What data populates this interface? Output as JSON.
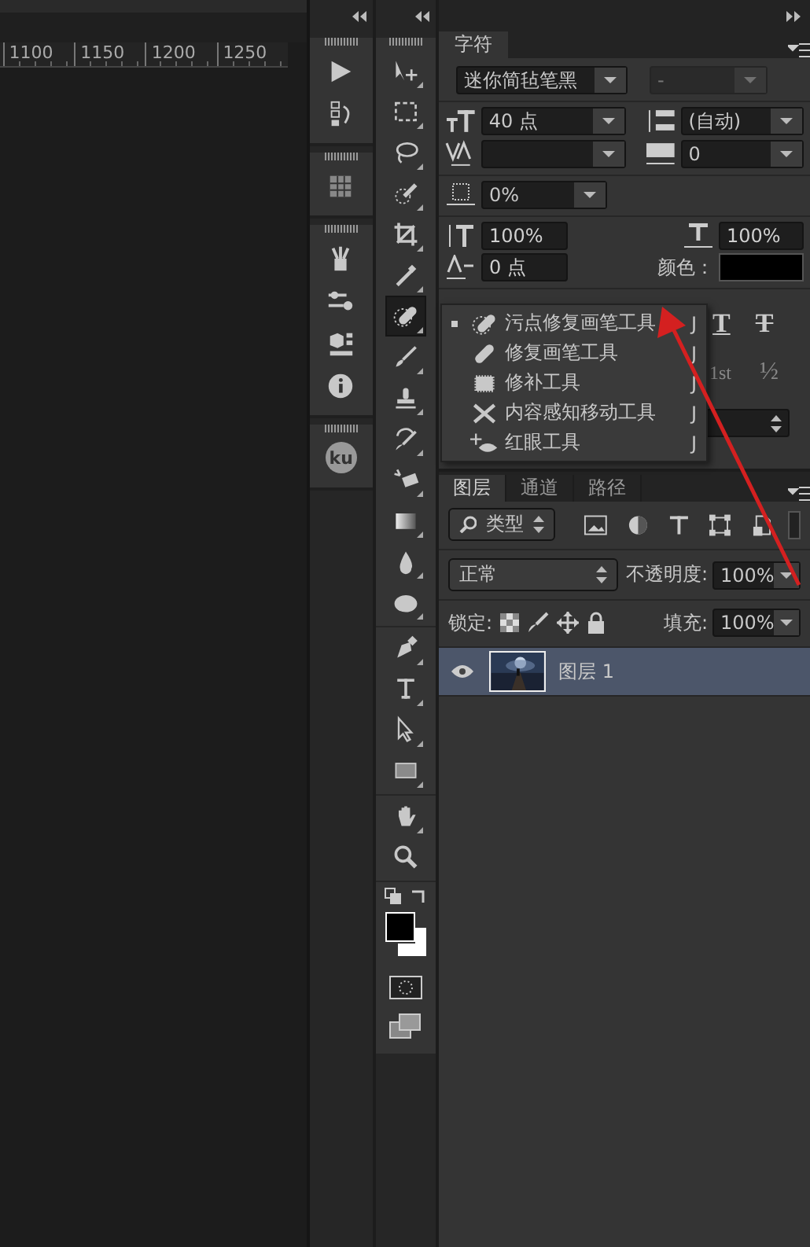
{
  "ruler": {
    "labels": [
      "1100",
      "1150",
      "1200",
      "1250"
    ]
  },
  "dock": {
    "groups": [
      {
        "items": [
          {
            "kind": "actions"
          },
          {
            "kind": "history"
          }
        ]
      },
      {
        "items": [
          {
            "kind": "swatches"
          }
        ]
      },
      {
        "items": [
          {
            "kind": "brushes"
          },
          {
            "kind": "brush-settings"
          },
          {
            "kind": "properties"
          },
          {
            "kind": "info"
          }
        ]
      },
      {
        "items": [
          {
            "kind": "ku",
            "label": "ku"
          }
        ]
      }
    ]
  },
  "toolbar": {
    "groups": [
      {
        "tools": [
          {
            "kind": "move",
            "selected": false,
            "flyout": true
          },
          {
            "kind": "marquee",
            "selected": false,
            "flyout": true
          },
          {
            "kind": "lasso",
            "selected": false,
            "flyout": true
          },
          {
            "kind": "quick-select",
            "selected": false,
            "flyout": true
          },
          {
            "kind": "crop",
            "selected": false,
            "flyout": true
          },
          {
            "kind": "eyedropper",
            "selected": false,
            "flyout": true
          },
          {
            "kind": "spot-healing",
            "selected": true,
            "flyout": true
          },
          {
            "kind": "brush",
            "selected": false,
            "flyout": true
          },
          {
            "kind": "stamp",
            "selected": false,
            "flyout": true
          },
          {
            "kind": "history-brush",
            "selected": false,
            "flyout": true
          },
          {
            "kind": "eraser",
            "selected": false,
            "flyout": true
          },
          {
            "kind": "gradient",
            "selected": false,
            "flyout": true
          },
          {
            "kind": "blur",
            "selected": false,
            "flyout": true
          },
          {
            "kind": "dodge",
            "selected": false,
            "flyout": true
          }
        ]
      },
      {
        "tools": [
          {
            "kind": "pen",
            "selected": false,
            "flyout": true
          },
          {
            "kind": "type",
            "selected": false,
            "flyout": true
          },
          {
            "kind": "path-select",
            "selected": false,
            "flyout": true
          },
          {
            "kind": "rectangle",
            "selected": false,
            "flyout": true
          }
        ]
      },
      {
        "tools": [
          {
            "kind": "hand",
            "selected": false,
            "flyout": true
          },
          {
            "kind": "zoom",
            "selected": false,
            "flyout": false
          }
        ]
      }
    ]
  },
  "character_panel": {
    "tab": "字符",
    "font_family": "迷你简毡笔黑",
    "font_style": "-",
    "font_style_disabled": true,
    "size": "40 点",
    "leading": "(自动)",
    "tracking": "0",
    "tsume": "0%",
    "vertical_scale": "100%",
    "horizontal_scale": "100%",
    "baseline_shift": "0 点",
    "color_label": "颜色：",
    "style_buttons": [
      {
        "kind": "underline",
        "label": "T"
      },
      {
        "kind": "strikethrough",
        "label": "T"
      }
    ],
    "opentype_buttons": [
      {
        "kind": "ordinal",
        "label": "1st"
      },
      {
        "kind": "fraction",
        "label": "½"
      }
    ]
  },
  "tool_menu": {
    "items": [
      {
        "kind": "spot-healing",
        "label": "污点修复画笔工具",
        "shortcut": "J",
        "selected": true
      },
      {
        "kind": "healing",
        "label": "修复画笔工具",
        "shortcut": "J",
        "selected": false
      },
      {
        "kind": "patch",
        "label": "修补工具",
        "shortcut": "J",
        "selected": false
      },
      {
        "kind": "content-aware-move",
        "label": "内容感知移动工具",
        "shortcut": "J",
        "selected": false
      },
      {
        "kind": "red-eye",
        "label": "红眼工具",
        "shortcut": "J",
        "selected": false
      }
    ]
  },
  "layers_panel": {
    "tabs": [
      {
        "label": "图层",
        "selected": true
      },
      {
        "label": "通道",
        "selected": false
      },
      {
        "label": "路径",
        "selected": false
      }
    ],
    "filter_type": "类型",
    "blend_mode": "正常",
    "opacity_label": "不透明度:",
    "opacity": "100%",
    "lock_label": "锁定:",
    "fill_label": "填充:",
    "fill": "100%",
    "layers": [
      {
        "name": "图层 1",
        "visible": true,
        "selected": true
      }
    ]
  }
}
